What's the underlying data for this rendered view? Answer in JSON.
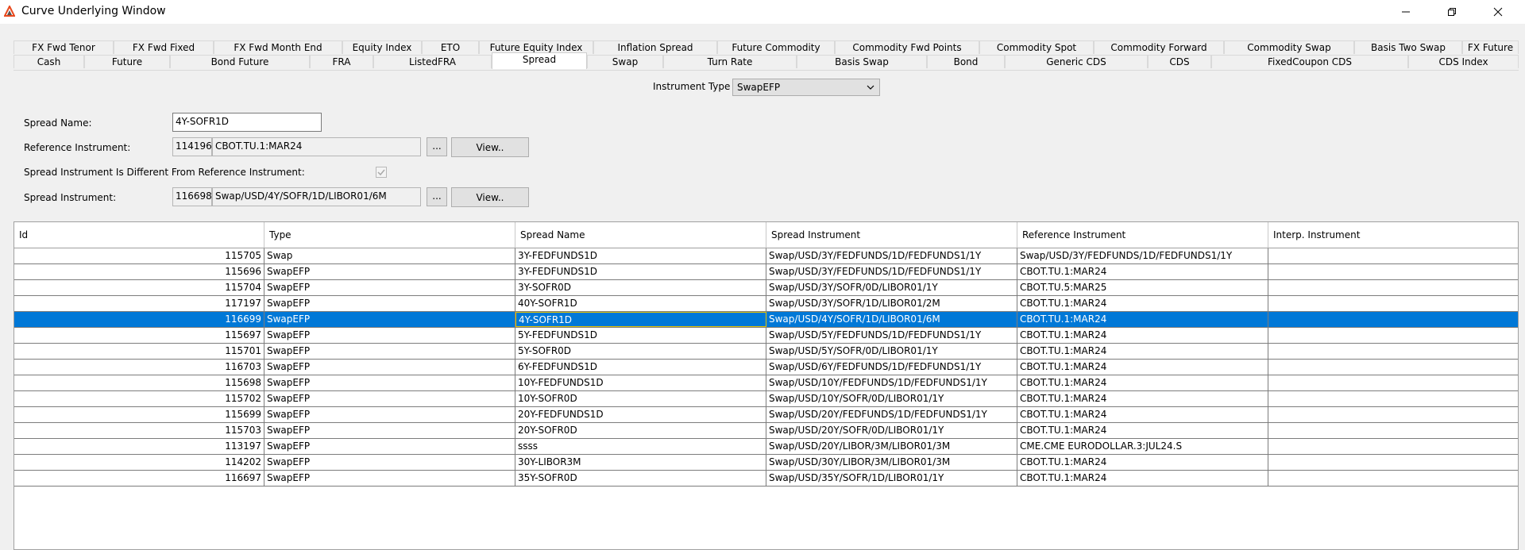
{
  "window": {
    "title": "Curve Underlying Window",
    "controls": {
      "minimize": "–",
      "restore": "❐",
      "close": "✕"
    }
  },
  "tabs_row1": [
    "FX Fwd Tenor",
    "FX Fwd Fixed",
    "FX Fwd Month End",
    "Equity Index",
    "ETO",
    "Future Equity Index",
    "Inflation Spread",
    "Future Commodity",
    "Commodity Fwd Points",
    "Commodity Spot",
    "Commodity Forward",
    "Commodity Swap",
    "Basis Two Swap",
    "FX Future"
  ],
  "tabs_row2": [
    "Cash",
    "Future",
    "Bond Future",
    "FRA",
    "ListedFRA",
    "Spread",
    "Swap",
    "Turn Rate",
    "Basis Swap",
    "Bond",
    "Generic CDS",
    "CDS",
    "FixedCoupon CDS",
    "CDS Index"
  ],
  "active_tab": "Spread",
  "form": {
    "instrument_type_label": "Instrument Type",
    "instrument_type_value": "SwapEFP",
    "spread_name_label": "Spread Name:",
    "spread_name_value": "4Y-SOFR1D",
    "reference_instrument_label": "Reference Instrument:",
    "reference_instrument_id": "114196",
    "reference_instrument_name": "CBOT.TU.1:MAR24",
    "different_label": "Spread Instrument Is Different From Reference Instrument:",
    "different_checked": true,
    "spread_instrument_label": "Spread Instrument:",
    "spread_instrument_id": "116698",
    "spread_instrument_name": "Swap/USD/4Y/SOFR/1D/LIBOR01/6M",
    "browse_label": "...",
    "view_label": "View.."
  },
  "table": {
    "columns": [
      "Id",
      "Type",
      "Spread Name",
      "Spread Instrument",
      "Reference Instrument",
      "Interp. Instrument"
    ],
    "selected_index": 4,
    "rows": [
      [
        "115705",
        "Swap",
        "3Y-FEDFUNDS1D",
        "Swap/USD/3Y/FEDFUNDS/1D/FEDFUNDS1/1Y",
        "Swap/USD/3Y/FEDFUNDS/1D/FEDFUNDS1/1Y",
        ""
      ],
      [
        "115696",
        "SwapEFP",
        "3Y-FEDFUNDS1D",
        "Swap/USD/3Y/FEDFUNDS/1D/FEDFUNDS1/1Y",
        "CBOT.TU.1:MAR24",
        ""
      ],
      [
        "115704",
        "SwapEFP",
        "3Y-SOFR0D",
        "Swap/USD/3Y/SOFR/0D/LIBOR01/1Y",
        "CBOT.TU.5:MAR25",
        ""
      ],
      [
        "117197",
        "SwapEFP",
        "40Y-SOFR1D",
        "Swap/USD/3Y/SOFR/1D/LIBOR01/2M",
        "CBOT.TU.1:MAR24",
        ""
      ],
      [
        "116699",
        "SwapEFP",
        "4Y-SOFR1D",
        "Swap/USD/4Y/SOFR/1D/LIBOR01/6M",
        "CBOT.TU.1:MAR24",
        ""
      ],
      [
        "115697",
        "SwapEFP",
        "5Y-FEDFUNDS1D",
        "Swap/USD/5Y/FEDFUNDS/1D/FEDFUNDS1/1Y",
        "CBOT.TU.1:MAR24",
        ""
      ],
      [
        "115701",
        "SwapEFP",
        "5Y-SOFR0D",
        "Swap/USD/5Y/SOFR/0D/LIBOR01/1Y",
        "CBOT.TU.1:MAR24",
        ""
      ],
      [
        "116703",
        "SwapEFP",
        "6Y-FEDFUNDS1D",
        "Swap/USD/6Y/FEDFUNDS/1D/FEDFUNDS1/1Y",
        "CBOT.TU.1:MAR24",
        ""
      ],
      [
        "115698",
        "SwapEFP",
        "10Y-FEDFUNDS1D",
        "Swap/USD/10Y/FEDFUNDS/1D/FEDFUNDS1/1Y",
        "CBOT.TU.1:MAR24",
        ""
      ],
      [
        "115702",
        "SwapEFP",
        "10Y-SOFR0D",
        "Swap/USD/10Y/SOFR/0D/LIBOR01/1Y",
        "CBOT.TU.1:MAR24",
        ""
      ],
      [
        "115699",
        "SwapEFP",
        "20Y-FEDFUNDS1D",
        "Swap/USD/20Y/FEDFUNDS/1D/FEDFUNDS1/1Y",
        "CBOT.TU.1:MAR24",
        ""
      ],
      [
        "115703",
        "SwapEFP",
        "20Y-SOFR0D",
        "Swap/USD/20Y/SOFR/0D/LIBOR01/1Y",
        "CBOT.TU.1:MAR24",
        ""
      ],
      [
        "113197",
        "SwapEFP",
        "ssss",
        "Swap/USD/20Y/LIBOR/3M/LIBOR01/3M",
        "CME.CME EURODOLLAR.3:JUL24.S",
        ""
      ],
      [
        "114202",
        "SwapEFP",
        "30Y-LIBOR3M",
        "Swap/USD/30Y/LIBOR/3M/LIBOR01/3M",
        "CBOT.TU.1:MAR24",
        ""
      ],
      [
        "116697",
        "SwapEFP",
        "35Y-SOFR0D",
        "Swap/USD/35Y/SOFR/1D/LIBOR01/1Y",
        "CBOT.TU.1:MAR24",
        ""
      ]
    ]
  },
  "colors": {
    "selection": "#0078d7",
    "focus_border": "#e8c400",
    "app_icon": "#e8481c"
  }
}
